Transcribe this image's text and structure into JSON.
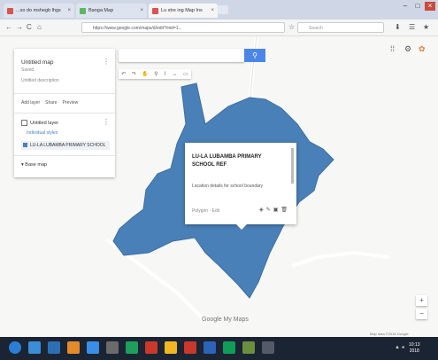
{
  "browser": {
    "tabs": [
      {
        "label": "...so do mshegb lhgs",
        "favicon_color": "#d9534f",
        "active": false
      },
      {
        "label": "Banga Map",
        "favicon_color": "#5cb85c",
        "active": false
      },
      {
        "label": "Lu stre ing Map Ins",
        "favicon_color": "#d9534f",
        "active": true
      }
    ],
    "url": "https://www.google.com/maps/d/edit?mid=1...",
    "search_placeholder": "Search",
    "nav": {
      "back": "←",
      "forward": "→",
      "reload": "C",
      "home": "⌂"
    },
    "window_controls": {
      "minimize": "–",
      "maximize": "□",
      "close": "×"
    }
  },
  "map_panel": {
    "title": "Untitled map",
    "subtitle": "Saved",
    "description": "Untitled description",
    "actions": [
      "Add layer",
      "Share",
      "Preview"
    ],
    "layer": {
      "name": "Untitled layer",
      "style_link": "Individual styles",
      "item": "LU-LA LUBAMBA PRIMARY SCHOOL"
    },
    "base_map": "Base map"
  },
  "map_search": {
    "button_icon": "search-icon"
  },
  "map_tools": [
    "↶",
    "↷",
    "✋",
    "⚲",
    "⌇",
    "↔",
    "▭"
  ],
  "popup": {
    "title": "LU-LA LUBAMBA PRIMARY SCHOOL   REF",
    "body": "Location details for school boundary",
    "footer": "Polygon · Edit"
  },
  "logo": "Google My Maps",
  "attribution": "Map data ©2018 Google",
  "taskbar": {
    "time": "10:13",
    "date": "2018",
    "icon_colors": [
      "#2a7fd4",
      "#3c8dd8",
      "#2e6fb3",
      "#e38b2b",
      "#3a8ee6",
      "#6b6b6b",
      "#1f9f5c",
      "#c9382a",
      "#f0b623",
      "#c9382a",
      "#2d63b8",
      "#0f9d58",
      "#6a8f3d",
      "#555b66"
    ]
  },
  "colors": {
    "polygon_fill": "#4a80b8",
    "accent": "#4a86e8",
    "taskbar": "#1b2433"
  }
}
